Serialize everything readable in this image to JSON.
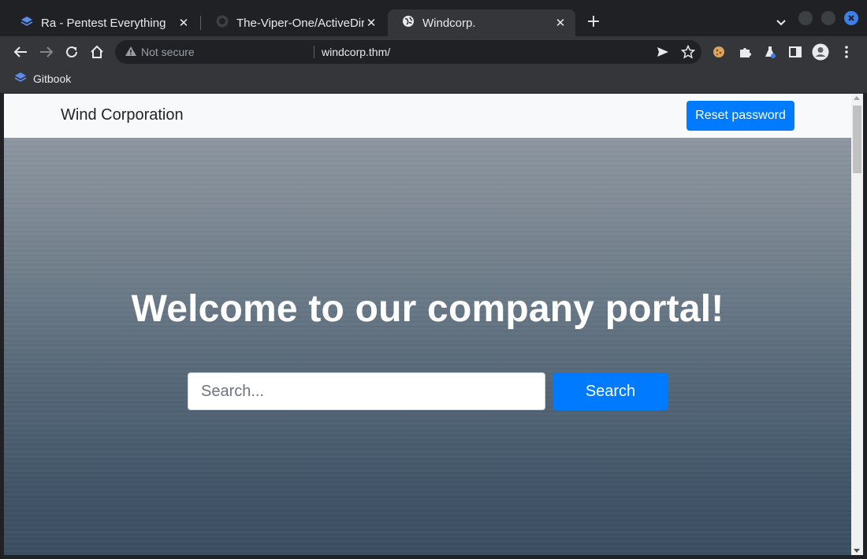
{
  "browser": {
    "tabs": [
      {
        "title": "Ra - Pentest Everything",
        "active": false,
        "icon": "gitbook-icon"
      },
      {
        "title": "The-Viper-One/ActiveDire",
        "active": false,
        "icon": "github-icon"
      },
      {
        "title": "Windcorp.",
        "active": true,
        "icon": "globe-icon"
      }
    ],
    "new_tab": "+",
    "tab_close": "✕",
    "security_label": "Not secure",
    "url": "windcorp.thm/",
    "bookmarks": [
      {
        "label": "Gitbook",
        "icon": "gitbook-icon"
      }
    ]
  },
  "page": {
    "brand": "Wind Corporation",
    "reset_button": "Reset password",
    "hero_title": "Welcome to our company portal!",
    "search_placeholder": "Search...",
    "search_button": "Search"
  },
  "colors": {
    "primary": "#007bff",
    "navbar_bg": "#f8f9fa",
    "browser_bg": "#202124",
    "toolbar_bg": "#35363a"
  }
}
